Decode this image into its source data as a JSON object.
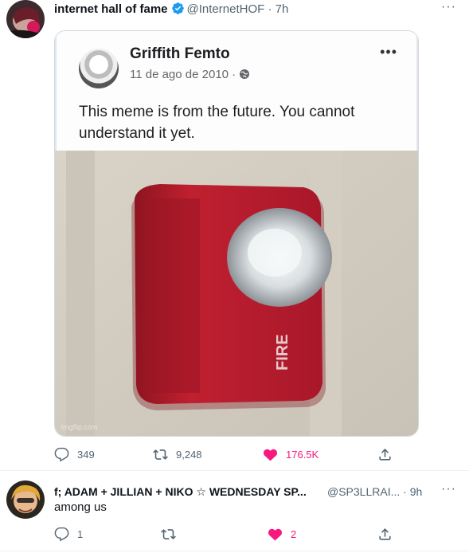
{
  "tweet": {
    "author_name": "internet hall of fame",
    "handle": "@InternetHOF",
    "time": "· 7h",
    "embedded_post": {
      "name": "Griffith Femto",
      "date": "11 de ago de 2010 ·",
      "text": "This meme is from the future. You cannot understand it yet.",
      "watermark": "imgflip.com",
      "photo_label": "FIRE"
    },
    "replies": "349",
    "retweets": "9,248",
    "likes": "176.5K"
  },
  "reply": {
    "author_name": "f; ADAM + JILLIAN + NIKO ☆ WEDNESDAY SP...",
    "handle": "@SP3LLRAI...",
    "time": "· 9h",
    "text": "among us",
    "replies": "1",
    "retweets": "",
    "likes": "2"
  },
  "colors": {
    "text": "#0f1419",
    "muted": "#536471",
    "verified": "#1d9bf0",
    "like": "#f91880"
  }
}
